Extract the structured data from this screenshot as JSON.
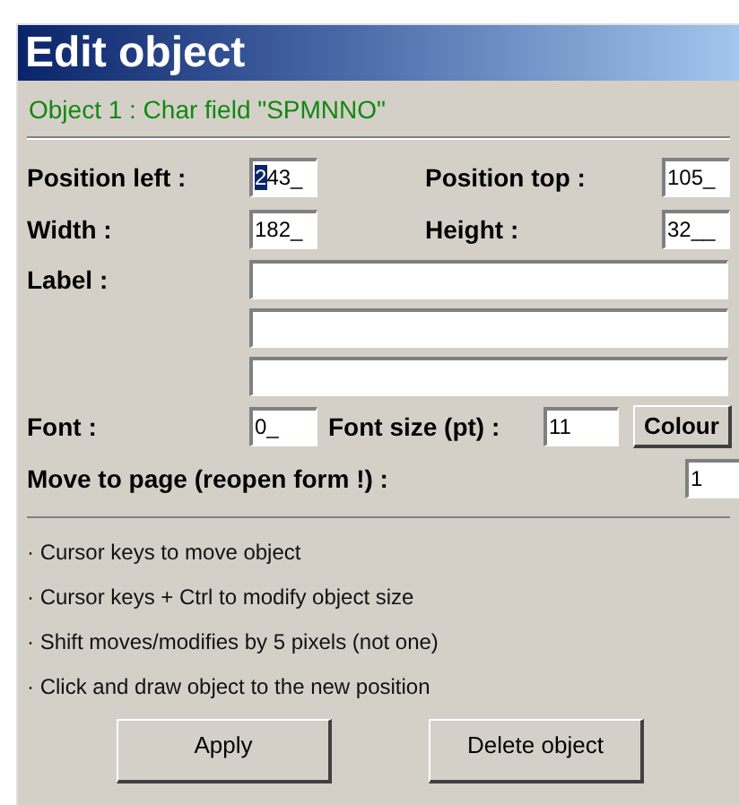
{
  "window": {
    "title": "Edit object"
  },
  "object_caption": "Object 1 : Char field \"SPMNNO\"",
  "position": [
    {
      "label": "Position left :",
      "value": "243_",
      "focused": true
    },
    {
      "label": "Position top :",
      "value": "105_",
      "focused": false
    }
  ],
  "size": [
    {
      "label": "Width :",
      "value": "182_",
      "focused": false
    },
    {
      "label": "Height :",
      "value": "32__",
      "focused": false
    }
  ],
  "label_field": {
    "label": "Label :",
    "lines": [
      {
        "kind": "text-line"
      },
      {
        "kind": "text-line"
      },
      {
        "kind": "text-line"
      }
    ]
  },
  "font": {
    "label": "Font :",
    "value": "0_",
    "focused": false
  },
  "font_size": {
    "label": "Font size (pt) :",
    "value": "11",
    "focused": false
  },
  "colour_button": "Colour",
  "move_to_page": {
    "label": "Move to page (reopen form !) :",
    "value": "1",
    "focused": false
  },
  "hints": [
    "· Cursor keys to move object",
    "· Cursor keys + Ctrl to modify object size",
    "· Shift moves/modifies by 5 pixels (not one)",
    "· Click and draw object to the new position"
  ],
  "buttons": [
    {
      "label": "Apply"
    },
    {
      "label": "Delete object"
    }
  ]
}
